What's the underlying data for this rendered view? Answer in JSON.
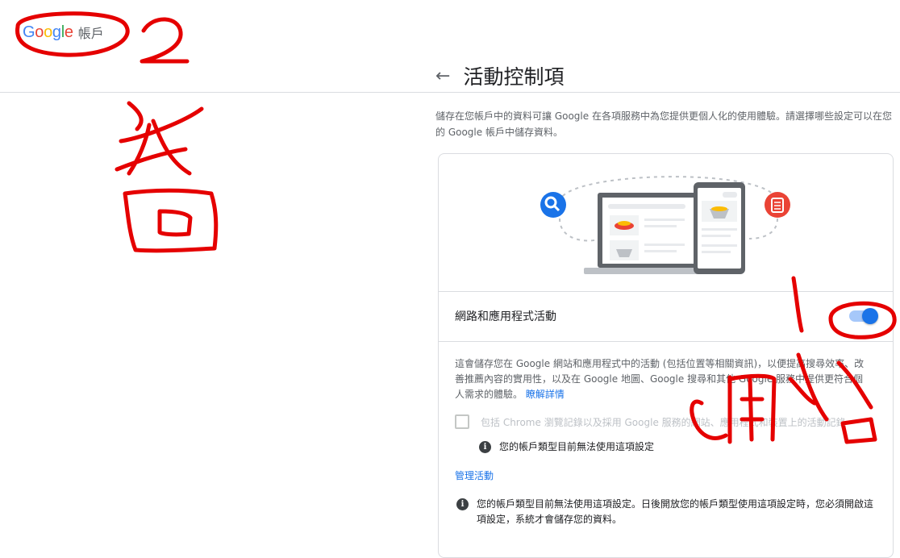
{
  "header": {
    "logo_letters": [
      {
        "ch": "G",
        "color": "#4285f4"
      },
      {
        "ch": "o",
        "color": "#ea4335"
      },
      {
        "ch": "o",
        "color": "#fbbc05"
      },
      {
        "ch": "g",
        "color": "#4285f4"
      },
      {
        "ch": "l",
        "color": "#34a853"
      },
      {
        "ch": "e",
        "color": "#ea4335"
      }
    ],
    "account_label": "帳戶"
  },
  "page": {
    "back_icon": "←",
    "title": "活動控制項",
    "intro": "儲存在您帳戶中的資料可讓 Google 在各項服務中為您提供更個人化的使用體驗。請選擇哪些設定可以在您的 Google 帳戶中儲存資料。"
  },
  "card": {
    "setting_title": "網路和應用程式活動",
    "toggle_on": true,
    "description": "這會儲存您在 Google 網站和應用程式中的活動 (包括位置等相關資訊)，以便提高搜尋效率、改善推薦內容的實用性，以及在 Google 地圖、Google 搜尋和其他 Google 服務中提供更符合個人需求的體驗。",
    "learn_more": "瞭解詳情",
    "checkbox_label": "包括 Chrome 瀏覽記錄以及採用 Google 服務的網站、應用程式和裝置上的活動記錄",
    "notice_short": "您的帳戶類型目前無法使用這項設定",
    "manage_link": "管理活動",
    "notice_long": "您的帳戶類型目前無法使用這項設定。日後開放您的帳戶類型使用這項設定時，您必須開啟這項設定，系統才會儲存您的資料。",
    "info_glyph": "i"
  },
  "colors": {
    "accent": "#1a73e8",
    "annotation": "#e50000",
    "search_badge": "#1a73e8",
    "doc_badge": "#ea4335"
  }
}
